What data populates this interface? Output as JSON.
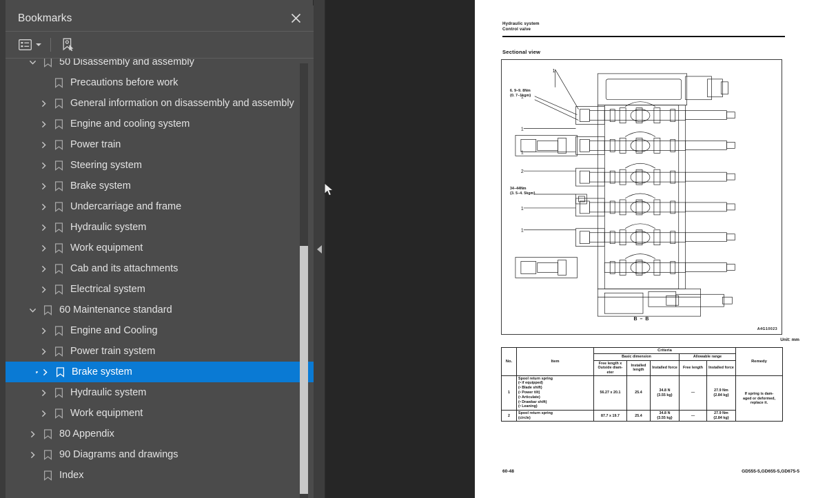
{
  "panel": {
    "title": "Bookmarks",
    "close_icon": "close-icon",
    "toolbar": {
      "options_icon": "list-options-icon",
      "dropdown_icon": "chevron-down-icon",
      "new_bookmark_icon": "new-bookmark-icon"
    },
    "items": [
      {
        "label": "50 Disassembly and assembly",
        "level": 0,
        "twisty": "expanded",
        "selected": false,
        "partial": true
      },
      {
        "label": "Precautions before work",
        "level": 1,
        "twisty": "none",
        "selected": false
      },
      {
        "label": "General information on disassembly and assembly",
        "level": 1,
        "twisty": "collapsed",
        "selected": false
      },
      {
        "label": "Engine and cooling system",
        "level": 1,
        "twisty": "collapsed",
        "selected": false
      },
      {
        "label": "Power train",
        "level": 1,
        "twisty": "collapsed",
        "selected": false
      },
      {
        "label": "Steering system",
        "level": 1,
        "twisty": "collapsed",
        "selected": false
      },
      {
        "label": "Brake system",
        "level": 1,
        "twisty": "collapsed",
        "selected": false
      },
      {
        "label": "Undercarriage and frame",
        "level": 1,
        "twisty": "collapsed",
        "selected": false
      },
      {
        "label": "Hydraulic system",
        "level": 1,
        "twisty": "collapsed",
        "selected": false
      },
      {
        "label": "Work equipment",
        "level": 1,
        "twisty": "collapsed",
        "selected": false
      },
      {
        "label": "Cab and its attachments",
        "level": 1,
        "twisty": "collapsed",
        "selected": false
      },
      {
        "label": "Electrical system",
        "level": 1,
        "twisty": "collapsed",
        "selected": false
      },
      {
        "label": "60 Maintenance standard",
        "level": 0,
        "twisty": "expanded",
        "selected": false
      },
      {
        "label": "Engine and Cooling",
        "level": 1,
        "twisty": "collapsed",
        "selected": false
      },
      {
        "label": "Power train system",
        "level": 1,
        "twisty": "collapsed",
        "selected": false
      },
      {
        "label": "Brake system",
        "level": 1,
        "twisty": "collapsed",
        "selected": true
      },
      {
        "label": "Hydraulic system",
        "level": 1,
        "twisty": "collapsed",
        "selected": false
      },
      {
        "label": "Work equipment",
        "level": 1,
        "twisty": "collapsed",
        "selected": false
      },
      {
        "label": "80 Appendix",
        "level": 0,
        "twisty": "collapsed",
        "selected": false
      },
      {
        "label": "90 Diagrams and drawings",
        "level": 0,
        "twisty": "collapsed",
        "selected": false
      },
      {
        "label": "Index",
        "level": 0,
        "twisty": "none",
        "selected": false
      }
    ],
    "selection_color": "#0a7ad4"
  },
  "collapse_handle": {
    "icon": "triangle-left-icon"
  },
  "document": {
    "header_line1": "Hydraulic system",
    "header_line2": "Control valve",
    "section_title": "Sectional view",
    "figure": {
      "section_label": "B – B",
      "drawing_code": "A4G10023",
      "annotations": [
        {
          "text": "6. 9−9. 8Nm\n{0. 7−1kgm}"
        },
        {
          "text": "34−44Nm\n{3. 5−4. 5kgm}"
        }
      ],
      "callouts": [
        "1",
        "1",
        "2",
        "1",
        "1",
        "1",
        "1"
      ]
    },
    "unit_note": "Unit: mm",
    "table": {
      "headers": {
        "no": "No.",
        "item": "Item",
        "criteria": "Criteria",
        "remedy": "Remedy",
        "basic_dimension": "Basic dimension",
        "allowable_range": "Allowable range",
        "free_length_outside": "Free length x Outside diam-\neter",
        "installed_length": "Installed\nlength",
        "installed_force": "Installed force",
        "free_length": "Free length",
        "allow_installed_force": "Installed force"
      },
      "rows": [
        {
          "no": "1",
          "item_title": "Spool return spring",
          "item_bullets": [
            "(• if equipped)",
            "(• Blade shift)",
            "(• Power tilt)",
            "(• Articulate)",
            "(• Drawbar shift)",
            "(• Leaning)"
          ],
          "free_outside": "56.27 x 20.1",
          "installed_length": "25.4",
          "installed_force": "34.8 N\n{3.55 kg}",
          "allow_free_length": "—",
          "allow_installed_force": "27.9 Nm\n{2.84 kg}",
          "remedy": "If spring is dam-\naged or deformed,\nreplace it."
        },
        {
          "no": "2",
          "item_title": "Spool return spring",
          "item_bullets": [
            "(circle)"
          ],
          "free_outside": "87.7 x 19.7",
          "installed_length": "25.4",
          "installed_force": "34.8 N\n{3.55 kg}",
          "allow_free_length": "—",
          "allow_installed_force": "27.9 Nm\n{2.84 kg}",
          "remedy": ""
        }
      ]
    },
    "footer_left": "60-48",
    "footer_right": "GD555-5,GD655-5,GD675-5"
  }
}
